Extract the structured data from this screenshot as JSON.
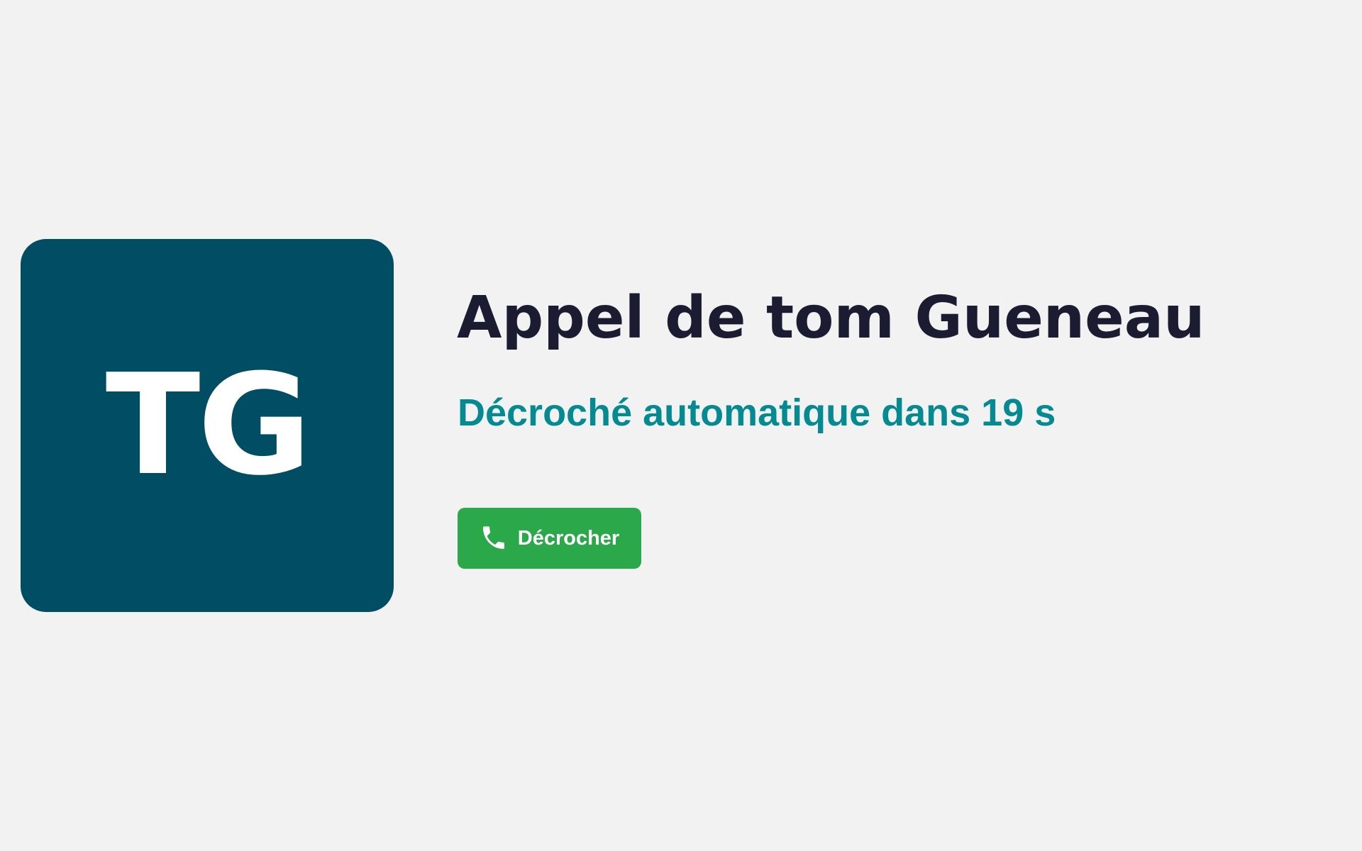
{
  "caller": {
    "initials": "TG",
    "title": "Appel de tom Gueneau",
    "avatar_color": "#014d63"
  },
  "auto_answer": {
    "text": "Décroché automatique dans 19 s",
    "countdown_seconds": 19
  },
  "actions": {
    "answer_label": "Décrocher",
    "answer_icon": "phone-icon",
    "answer_color": "#2aa84a"
  },
  "theme": {
    "background": "#f2f2f2",
    "title_color": "#1b1b32",
    "accent_color": "#068a92"
  }
}
